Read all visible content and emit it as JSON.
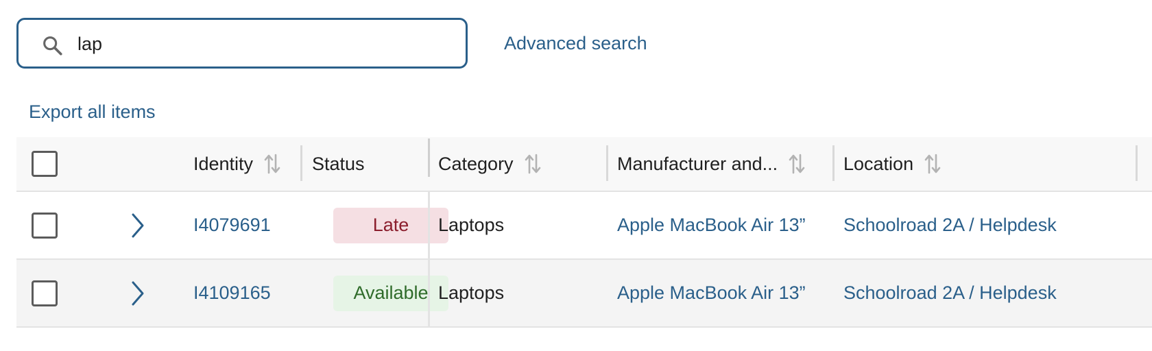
{
  "search": {
    "value": "lap",
    "placeholder": ""
  },
  "links": {
    "advanced_search": "Advanced search",
    "export_all": "Export all items"
  },
  "table": {
    "columns": {
      "identity": "Identity",
      "status": "Status",
      "category": "Category",
      "manufacturer": "Manufacturer and...",
      "location": "Location"
    },
    "rows": [
      {
        "identity": "I4079691",
        "status": "Late",
        "category": "Laptops",
        "manufacturer": "Apple MacBook Air 13”",
        "location": "Schoolroad 2A / Helpdesk"
      },
      {
        "identity": "I4109165",
        "status": "Available",
        "category": "Laptops",
        "manufacturer": "Apple MacBook Air 13”",
        "location": "Schoolroad 2A / Helpdesk"
      }
    ]
  },
  "colors": {
    "accent": "#2a5f8a",
    "late_bg": "#f5dfe3",
    "late_text": "#8b1e2d",
    "available_bg": "#e6f4e6",
    "available_text": "#2f6b2a"
  },
  "icons": {
    "search": "search-icon",
    "sort": "sort-icon",
    "expand": "chevron-right-icon"
  }
}
